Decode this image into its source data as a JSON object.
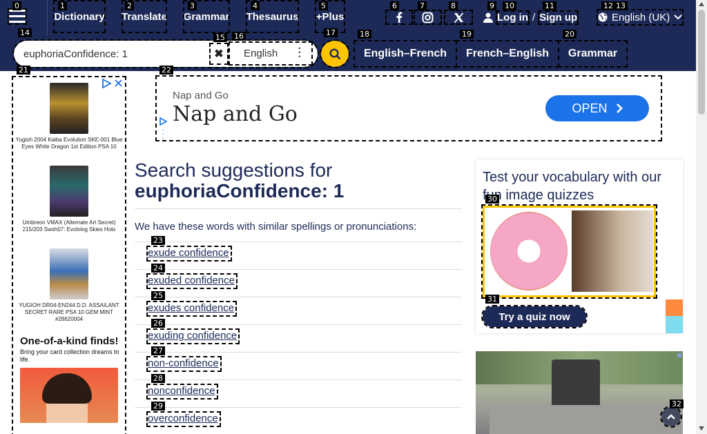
{
  "nav": {
    "items": [
      "Dictionary",
      "Translate",
      "Grammar",
      "Thesaurus",
      "+Plus"
    ],
    "social": [
      "facebook-icon",
      "instagram-icon",
      "x-icon"
    ],
    "login": "Log in",
    "login_sep": "/",
    "signup": "Sign up",
    "language": "English (UK)"
  },
  "search": {
    "query": "euphoriaConfidence: 1",
    "language": "English",
    "quick_links": [
      "English–French",
      "French–English",
      "Grammar"
    ]
  },
  "left_ad": {
    "items": [
      "Yugioh 2004 Kaiba Evolution SKE-001 Blue Eyes White Dragon 1st Edition PSA 10",
      "Umbreon VMAX (Alternate Art Secret) 215/203 Swsh07: Evolving Skies Holo",
      "YUGIOH DR04-EN244 D.D. ASSAILANT SECRET RARE PSA 10 GEM MINT #28620004"
    ],
    "promo_title": "One-of-a-kind finds!",
    "promo_text": "Bring your card collection dreams to life."
  },
  "banner_ad": {
    "small": "Nap and Go",
    "big": "Nap and Go",
    "button": "OPEN"
  },
  "results": {
    "heading_prefix": "Search suggestions for",
    "heading_term": "euphoriaConfidence: 1",
    "intro": "We have these words with similar spellings or pronunciations:",
    "suggestions": [
      "exude confidence",
      "exuded confidence",
      "exudes confidence",
      "exuding confidence",
      "non-confidence",
      "nonconfidence",
      "overconfidence"
    ]
  },
  "quiz": {
    "title": "Test your vocabulary with our fun image quizzes",
    "button": "Try a quiz now"
  },
  "labels": [
    "0",
    "1",
    "2",
    "3",
    "4",
    "5",
    "6",
    "7",
    "8",
    "9",
    "10",
    "11",
    "12",
    "13",
    "14",
    "15",
    "16",
    "17",
    "18",
    "19",
    "20",
    "21",
    "22",
    "23",
    "24",
    "25",
    "26",
    "27",
    "28",
    "29",
    "30",
    "31",
    "32"
  ],
  "colors": {
    "navy": "#1d2a57",
    "yellow": "#fec400",
    "ad_blue": "#1a73e8"
  }
}
